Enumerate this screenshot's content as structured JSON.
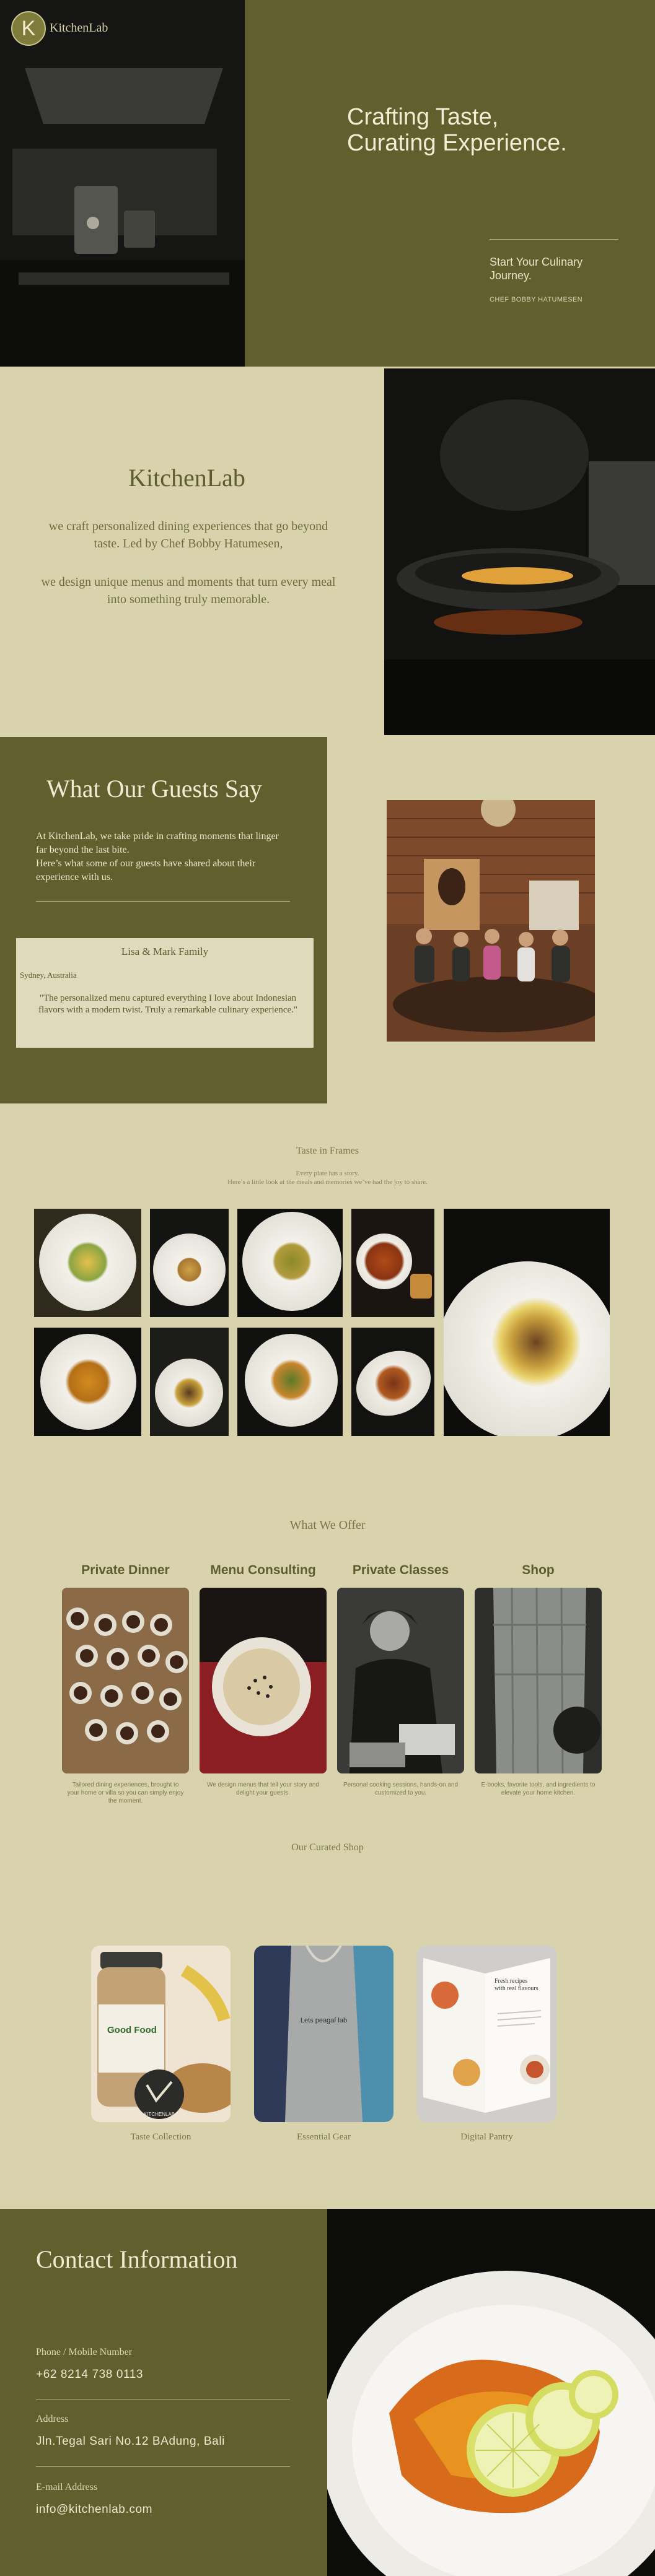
{
  "brand": {
    "logo_letter": "K",
    "name": "KitchenLab"
  },
  "hero": {
    "headline_1": "Crafting Taste,",
    "headline_2": "Curating Experience.",
    "cta_1": "Start Your Culinary",
    "cta_2": "Journey.",
    "byline": "CHEF BOBBY HATUMESEN"
  },
  "about": {
    "title": "KitchenLab",
    "p1_line1": "we craft personalized dining experiences that go beyond",
    "p1_line2": "taste. Led by Chef Bobby Hatumesen,",
    "p2_line1": "we design unique menus and moments that turn every meal",
    "p2_line2": "into something truly memorable."
  },
  "testimonials": {
    "title": "What Our Guests Say",
    "intro_1": "At KitchenLab, we take pride in crafting moments that linger",
    "intro_2": "far beyond the last bite.",
    "intro_3": "Here’s what some of our guests have shared about their",
    "intro_4": "experience with us.",
    "card": {
      "name": "Lisa & Mark Family",
      "location": "Sydney, Australia",
      "quote_1": "\"The personalized menu captured everything I love about Indonesian",
      "quote_2": "flavors with a modern twist. Truly a remarkable culinary experience.\""
    }
  },
  "gallery": {
    "title": "Taste in Frames",
    "sub_1": "Every plate has a story.",
    "sub_2": "Here’s a little look at the meals and memories we’ve had the joy to share."
  },
  "offer": {
    "title": "What We Offer",
    "services": [
      {
        "name": "Private Dinner",
        "desc_1": "Tailored dining experiences, brought to",
        "desc_2": "your home or villa so you can simply enjoy",
        "desc_3": "the moment."
      },
      {
        "name": "Menu Consulting",
        "desc_1": "We design menus that tell your story and",
        "desc_2": "delight your guests.",
        "desc_3": ""
      },
      {
        "name": "Private Classes",
        "desc_1": "Personal cooking sessions, hands-on and",
        "desc_2": "customized to you.",
        "desc_3": ""
      },
      {
        "name": "Shop",
        "desc_1": "E-books, favorite tools, and ingredients to",
        "desc_2": "elevate your home kitchen.",
        "desc_3": ""
      }
    ]
  },
  "shop": {
    "title": "Our Curated Shop",
    "items": [
      {
        "caption": "Taste Collection",
        "jar_label": "Good Food",
        "tag": "KITCHENLAB"
      },
      {
        "caption": "Essential Gear",
        "apron_text": "Lets peagaf lab"
      },
      {
        "caption": "Digital Pantry",
        "book_text_1": "Fresh recipes",
        "book_text_2": "with real flavours"
      }
    ]
  },
  "contact": {
    "title": "Contact Information",
    "phone_label": "Phone / Mobile Number",
    "phone": "+62 8214 738 0113",
    "address_label": "Address",
    "address": "Jln.Tegal Sari No.12 BAdung, Bali",
    "email_label": "E-mail Address",
    "email": "info@kitchenlab.com"
  },
  "colors": {
    "olive": "#615f2e",
    "cream": "#d8d3ad",
    "text": "#5e5c2d"
  }
}
